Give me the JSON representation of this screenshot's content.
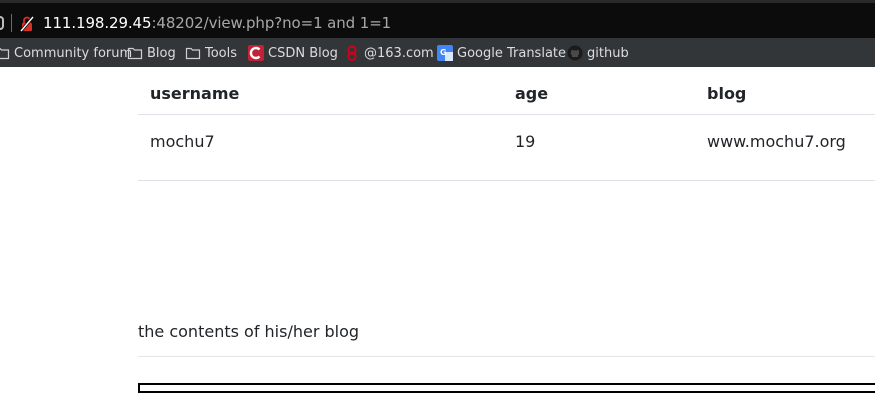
{
  "browser": {
    "url_host": "111.198.29.45",
    "url_rest": ":48202/view.php?no=1 and 1=1",
    "bookmarks": [
      {
        "label": "Community forum",
        "icon": "folder-icon"
      },
      {
        "label": "Blog",
        "icon": "folder-icon"
      },
      {
        "label": "Tools",
        "icon": "folder-icon"
      },
      {
        "label": "CSDN Blog",
        "icon": "csdn-icon"
      },
      {
        "label": "@163.com",
        "icon": "netease-icon"
      },
      {
        "label": "Google Translate",
        "icon": "google-translate-icon"
      },
      {
        "label": "github",
        "icon": "github-icon"
      }
    ]
  },
  "table": {
    "headers": [
      "username",
      "age",
      "blog"
    ],
    "rows": [
      [
        "mochu7",
        "19",
        "www.mochu7.org"
      ]
    ]
  },
  "blog_contents": "the contents of his/her blog",
  "colors": {
    "address_bar": "#0c0c0c",
    "bookmarks_bar": "#323639",
    "csdn_red": "#c32136",
    "netease_red": "#d0021b",
    "translate_blue": "#4285f4"
  }
}
